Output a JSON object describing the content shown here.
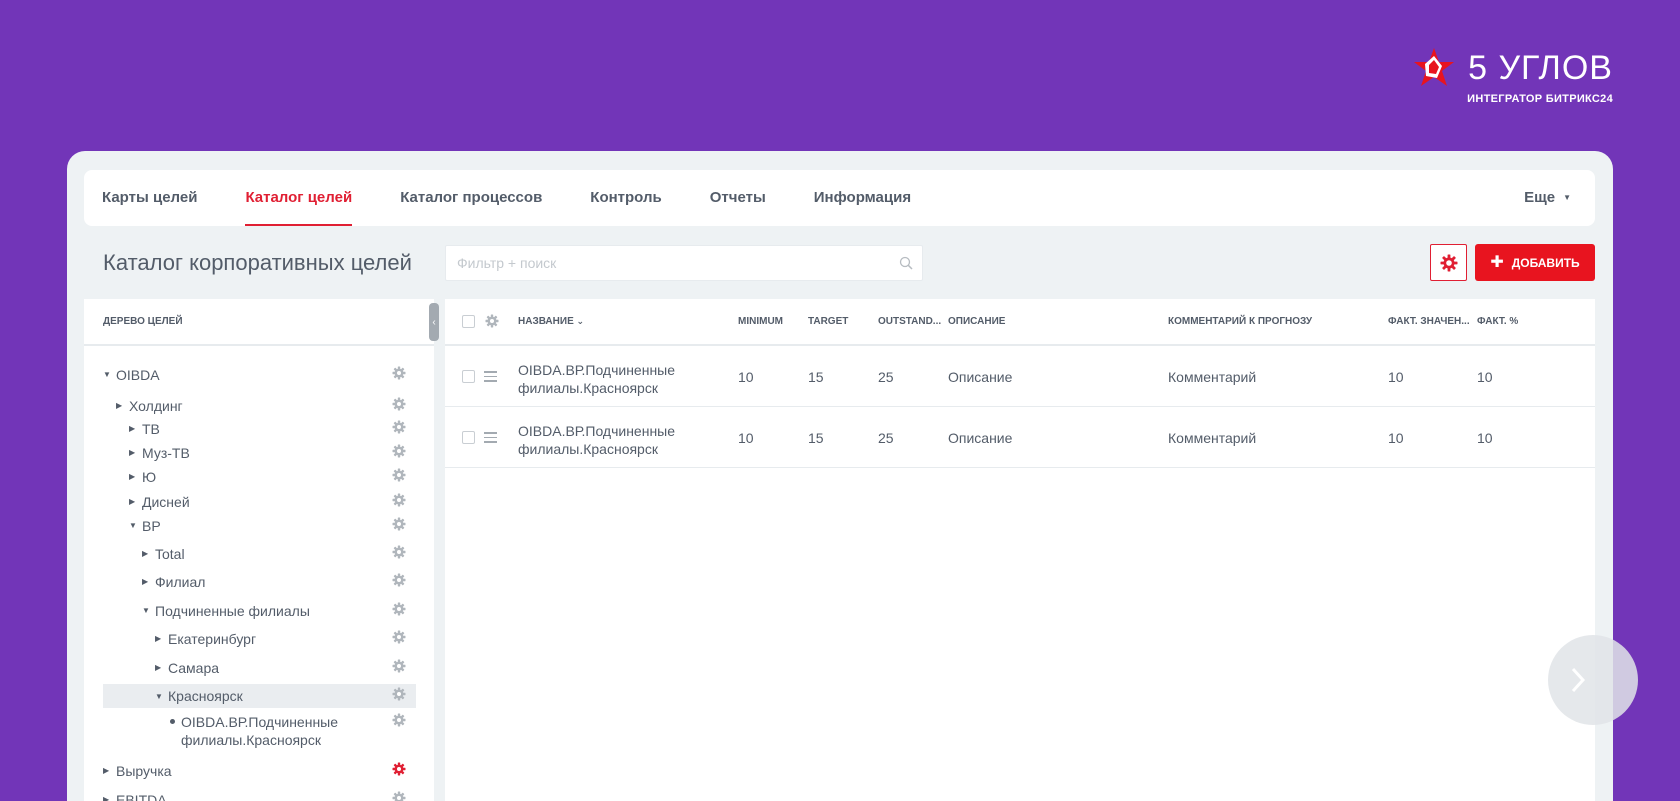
{
  "brand": {
    "name": "5 УГЛОВ",
    "subtitle": "ИНТЕГРАТОР БИТРИКС24",
    "logo_icon": "red-star-logo-icon"
  },
  "colors": {
    "background": "#7235b8",
    "accent": "#e01f33",
    "add_button": "#e8141f",
    "panel": "#eef2f4"
  },
  "nav": {
    "items": [
      {
        "label": "Карты целей",
        "active": false
      },
      {
        "label": "Каталог целей",
        "active": true
      },
      {
        "label": "Каталог процессов",
        "active": false
      },
      {
        "label": "Контроль",
        "active": false
      },
      {
        "label": "Отчеты",
        "active": false
      },
      {
        "label": "Информация",
        "active": false
      }
    ],
    "more_label": "Еще"
  },
  "page": {
    "title": "Каталог корпоративных целей",
    "filter_placeholder": "Фильтр + поиск",
    "add_label": "ДОБАВИТЬ"
  },
  "tree": {
    "header": "ДЕРЕВО ЦЕЛЕЙ",
    "items": [
      {
        "label": "OIBDA",
        "expanded": true,
        "type": "arrow"
      },
      {
        "label": "Холдинг",
        "expanded": false,
        "type": "arrow"
      },
      {
        "label": "ТВ",
        "expanded": false,
        "type": "arrow"
      },
      {
        "label": "Муз-ТВ",
        "expanded": false,
        "type": "arrow"
      },
      {
        "label": "Ю",
        "expanded": false,
        "type": "arrow"
      },
      {
        "label": "Дисней",
        "expanded": false,
        "type": "arrow"
      },
      {
        "label": "ВР",
        "expanded": true,
        "type": "arrow"
      },
      {
        "label": "Total",
        "expanded": false,
        "type": "arrow"
      },
      {
        "label": "Филиал",
        "expanded": false,
        "type": "arrow"
      },
      {
        "label": "Подчиненные филиалы",
        "expanded": true,
        "type": "arrow"
      },
      {
        "label": "Екатеринбург",
        "expanded": false,
        "type": "arrow"
      },
      {
        "label": "Самара",
        "expanded": false,
        "type": "arrow"
      },
      {
        "label": "Красноярск",
        "expanded": true,
        "type": "arrow",
        "selected": true
      },
      {
        "label_line1": "OIBDA.ВР.Подчиненные",
        "label_line2": "филиалы.Красноярск",
        "type": "dot"
      },
      {
        "label": "Выручка",
        "expanded": false,
        "type": "arrow",
        "gear_active": true
      },
      {
        "label": "EBITDA",
        "expanded": false,
        "type": "arrow"
      }
    ]
  },
  "table": {
    "columns": {
      "name": "НАЗВАНИЕ",
      "minimum": "MINIMUM",
      "target": "TARGET",
      "outstanding": "OUTSTAND...",
      "description": "ОПИСАНИЕ",
      "comment": "КОММЕНТАРИЙ К ПРОГНОЗУ",
      "fact_value": "ФАКТ. ЗНАЧЕН...",
      "fact_percent": "ФАКТ. %"
    },
    "rows": [
      {
        "name_line1": "OIBDA.ВР.Подчиненные",
        "name_line2": "филиалы.Красноярск",
        "minimum": "10",
        "target": "15",
        "outstanding": "25",
        "description": "Описание",
        "comment": "Комментарий",
        "fact_value": "10",
        "fact_percent": "10"
      },
      {
        "name_line1": "OIBDA.ВР.Подчиненные",
        "name_line2": "филиалы.Красноярск",
        "minimum": "10",
        "target": "15",
        "outstanding": "25",
        "description": "Описание",
        "comment": "Комментарий",
        "fact_value": "10",
        "fact_percent": "10"
      }
    ]
  }
}
